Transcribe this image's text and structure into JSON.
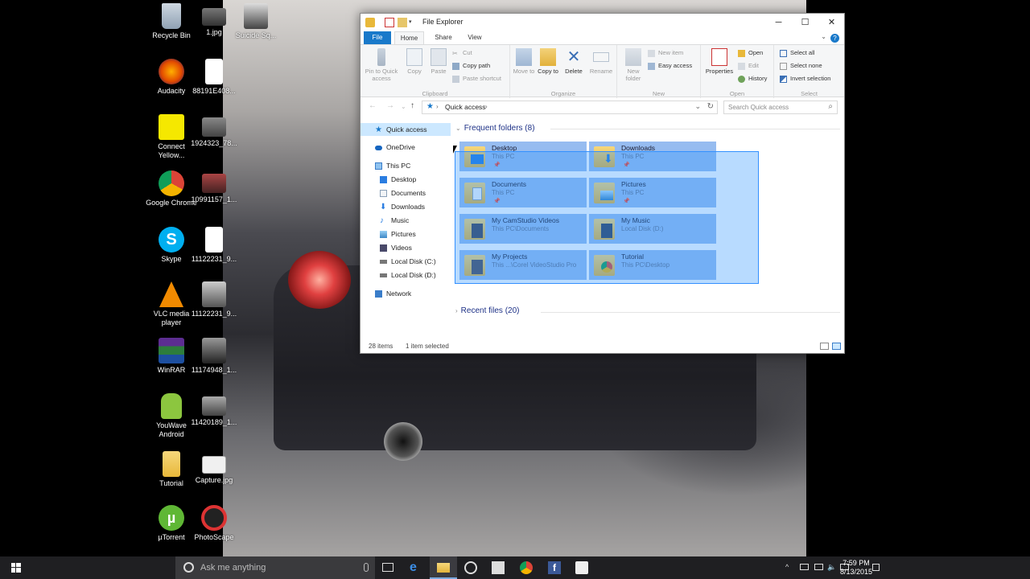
{
  "desktop": {
    "icons_left": [
      {
        "name": "recycle-bin-icon",
        "label": "Recycle Bin"
      },
      {
        "name": "audacity-icon",
        "label": "Audacity"
      },
      {
        "name": "connect-yellow-icon",
        "label": "Connect Yellow..."
      },
      {
        "name": "google-chrome-icon",
        "label": "Google Chrome"
      },
      {
        "name": "skype-icon",
        "label": "Skype"
      },
      {
        "name": "vlc-icon",
        "label": "VLC media player"
      },
      {
        "name": "winrar-icon",
        "label": "WinRAR"
      },
      {
        "name": "youwave-android-icon",
        "label": "YouWave Android"
      },
      {
        "name": "tutorial-icon",
        "label": "Tutorial"
      },
      {
        "name": "utorrent-icon",
        "label": "µTorrent"
      }
    ],
    "icons_right": [
      {
        "name": "image-file-icon",
        "label": "1.jpg"
      },
      {
        "name": "blank-file-icon",
        "label": "88191E408..."
      },
      {
        "name": "image-file-icon",
        "label": "1924323_78..."
      },
      {
        "name": "image-file-icon",
        "label": "10991157_1..."
      },
      {
        "name": "blank-file-icon",
        "label": "11122231_9..."
      },
      {
        "name": "image-file-icon",
        "label": "11122231_9..."
      },
      {
        "name": "image-file-icon",
        "label": "11174948_1..."
      },
      {
        "name": "image-file-icon",
        "label": "11420189_1..."
      },
      {
        "name": "image-file-icon",
        "label": "Capture.jpg"
      },
      {
        "name": "photoscape-icon",
        "label": "PhotoScape"
      }
    ],
    "icon_third": {
      "name": "suicide-squad-icon",
      "label": "Suicide Sq..."
    }
  },
  "explorer": {
    "title": "File Explorer",
    "tabs": {
      "file": "File",
      "home": "Home",
      "share": "Share",
      "view": "View"
    },
    "ribbon": {
      "pin": "Pin to Quick access",
      "copy": "Copy",
      "paste": "Paste",
      "cut": "Cut",
      "copy_path": "Copy path",
      "paste_shortcut": "Paste shortcut",
      "clipboard": "Clipboard",
      "move_to": "Move to",
      "copy_to": "Copy to",
      "delete": "Delete",
      "rename": "Rename",
      "organize": "Organize",
      "new_folder": "New folder",
      "new_item": "New item",
      "easy_access": "Easy access",
      "new": "New",
      "properties": "Properties",
      "open": "Open",
      "edit": "Edit",
      "history": "History",
      "open_group": "Open",
      "select_all": "Select all",
      "select_none": "Select none",
      "invert_selection": "Invert selection",
      "select_group": "Select"
    },
    "address": "Quick access",
    "search_placeholder": "Search Quick access",
    "nav": [
      {
        "name": "nav-quick-access",
        "label": "Quick access",
        "selected": true
      },
      {
        "name": "nav-onedrive",
        "label": "OneDrive"
      },
      {
        "name": "nav-this-pc",
        "label": "This PC"
      },
      {
        "name": "nav-desktop",
        "label": "Desktop"
      },
      {
        "name": "nav-documents",
        "label": "Documents"
      },
      {
        "name": "nav-downloads",
        "label": "Downloads"
      },
      {
        "name": "nav-music",
        "label": "Music"
      },
      {
        "name": "nav-pictures",
        "label": "Pictures"
      },
      {
        "name": "nav-videos",
        "label": "Videos"
      },
      {
        "name": "nav-local-disk-c",
        "label": "Local Disk (C:)"
      },
      {
        "name": "nav-local-disk-d",
        "label": "Local Disk (D:)"
      },
      {
        "name": "nav-network",
        "label": "Network"
      }
    ],
    "frequent_header": "Frequent folders (8)",
    "recent_header": "Recent files (20)",
    "folders": [
      {
        "name": "Desktop",
        "location": "This PC",
        "pinned": true
      },
      {
        "name": "Downloads",
        "location": "This PC",
        "pinned": true
      },
      {
        "name": "Documents",
        "location": "This PC",
        "pinned": true
      },
      {
        "name": "Pictures",
        "location": "This PC",
        "pinned": true
      },
      {
        "name": "My CamStudio Videos",
        "location": "This PC\\Documents",
        "pinned": false
      },
      {
        "name": "My Music",
        "location": "Local Disk (D:)",
        "pinned": false
      },
      {
        "name": "My Projects",
        "location": "This ...\\Corel VideoStudio Pro",
        "pinned": false
      },
      {
        "name": "Tutorial",
        "location": "This PC\\Desktop",
        "pinned": false
      }
    ],
    "status_count": "28 items",
    "status_selected": "1 item selected"
  },
  "taskbar": {
    "search_placeholder": "Ask me anything",
    "time": "7:59 PM",
    "date": "8/13/2015"
  },
  "colors": {
    "accent": "#1979ca",
    "selection_tile": "#96bcf0",
    "taskbar": "#1f1f22"
  }
}
